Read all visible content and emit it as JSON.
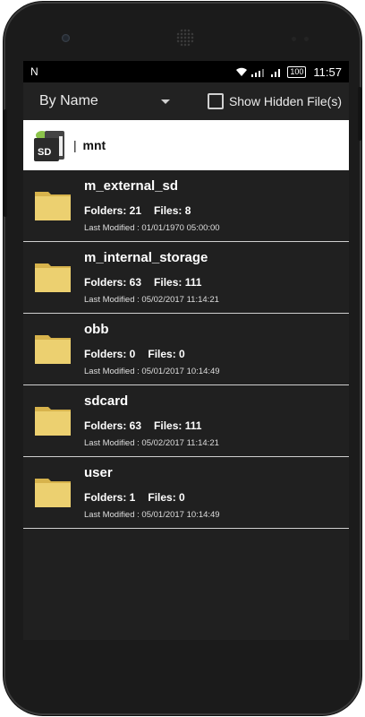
{
  "status": {
    "notification": "N",
    "battery_percent": "100",
    "time": "11:57"
  },
  "toolbar": {
    "sort_label": "By Name",
    "show_hidden_label": "Show Hidden File(s)",
    "show_hidden_checked": false
  },
  "path": {
    "separator": "|",
    "current": "mnt",
    "icon_label": "SD"
  },
  "folders": [
    {
      "name": "m_external_sd",
      "folders": "Folders: 21",
      "files": "Files: 8",
      "modified": "Last Modified : 01/01/1970 05:00:00"
    },
    {
      "name": "m_internal_storage",
      "folders": "Folders: 63",
      "files": "Files: 111",
      "modified": "Last Modified : 05/02/2017 11:14:21"
    },
    {
      "name": "obb",
      "folders": "Folders: 0",
      "files": "Files: 0",
      "modified": "Last Modified : 05/01/2017 10:14:49"
    },
    {
      "name": "sdcard",
      "folders": "Folders: 63",
      "files": "Files: 111",
      "modified": "Last Modified : 05/02/2017 11:14:21"
    },
    {
      "name": "user",
      "folders": "Folders: 1",
      "files": "Files: 0",
      "modified": "Last Modified : 05/01/2017 10:14:49"
    }
  ],
  "colors": {
    "background": "#202020",
    "folder_yellow": "#e9c85f",
    "pathbar": "#ffffff",
    "sd_green": "#8bc34a"
  }
}
